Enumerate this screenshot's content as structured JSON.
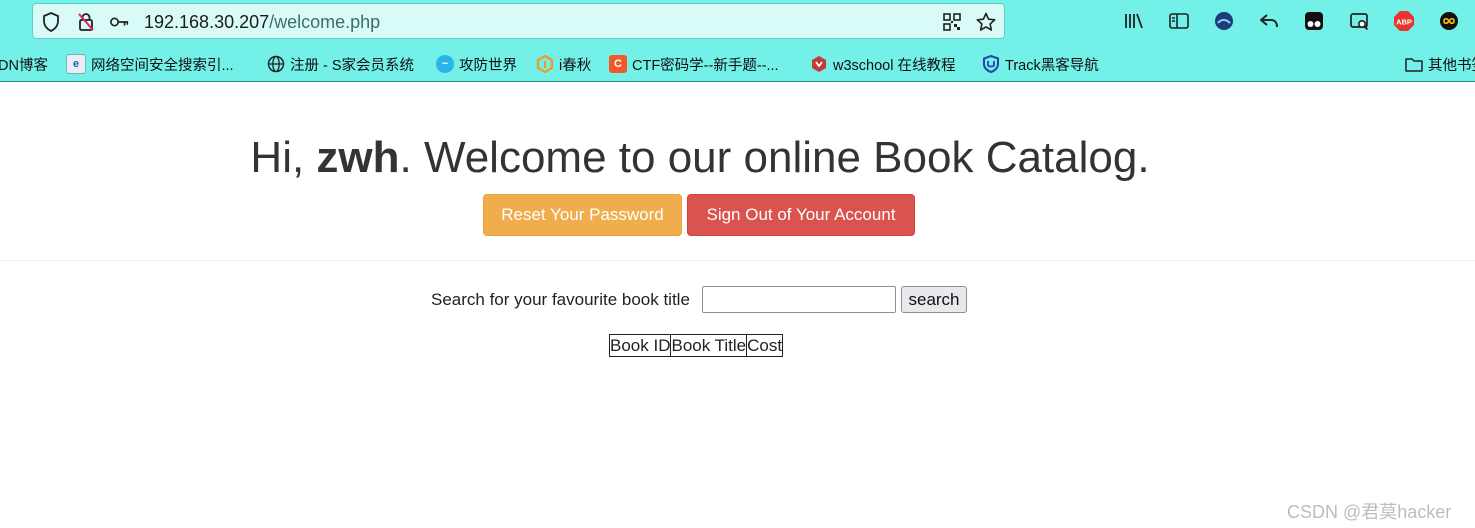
{
  "browser": {
    "url_host": "192.168.30.207",
    "url_path": "/welcome.php",
    "bookmarks": [
      "DN博客",
      "网络空间安全搜索引...",
      "注册 - S家会员系统",
      "攻防世界",
      "i春秋",
      "CTF密码学--新手题--...",
      "w3school 在线教程",
      "Track黑客导航",
      "其他书签"
    ]
  },
  "page": {
    "greeting_prefix": "Hi, ",
    "username": "zwh",
    "greeting_suffix": ". Welcome to our online Book Catalog.",
    "reset_password_label": "Reset Your Password",
    "sign_out_label": "Sign Out of Your Account",
    "search_label": "Search for your favourite book title",
    "search_value": "",
    "search_button_label": "search",
    "table_headers": [
      "Book ID",
      "Book Title",
      "Cost"
    ]
  },
  "watermark": "CSDN @君莫hacker",
  "colors": {
    "chrome_bg": "#73f0e8",
    "warning": "#f0ad4e",
    "danger": "#d9534f"
  }
}
